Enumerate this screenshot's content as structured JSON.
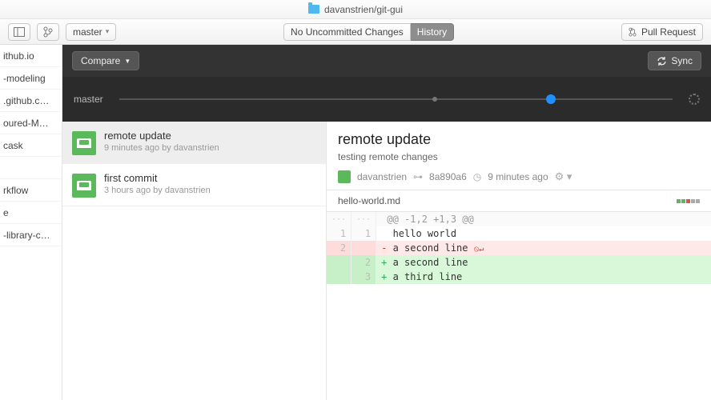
{
  "titlebar": {
    "path": "davanstrien/git-gui"
  },
  "toolbar": {
    "branch": "master",
    "tabs": {
      "changes": "No Uncommitted Changes",
      "history": "History"
    },
    "pull_request": "Pull Request"
  },
  "compare": {
    "label": "Compare",
    "sync": "Sync"
  },
  "timeline": {
    "branch_label": "master"
  },
  "repos": [
    "ithub.io",
    "-modeling",
    ".github.c…",
    "oured-M…",
    "cask",
    "",
    "rkflow",
    "e",
    "-library-c…"
  ],
  "commits": [
    {
      "title": "remote update",
      "sub": "9 minutes ago by davanstrien",
      "selected": true
    },
    {
      "title": "first commit",
      "sub": "3 hours ago by davanstrien",
      "selected": false
    }
  ],
  "detail": {
    "title": "remote update",
    "desc": "testing remote changes",
    "author": "davanstrien",
    "sha": "8a890a6",
    "time": "9 minutes ago",
    "file": "hello-world.md",
    "dots": [
      "#5bb85b",
      "#5bb85b",
      "#d9534f",
      "#aaa",
      "#aaa"
    ]
  },
  "diff": {
    "hunk": "@@ -1,2 +1,3 @@",
    "rows": [
      {
        "old": "1",
        "new": "1",
        "type": "ctx",
        "text": "hello world"
      },
      {
        "old": "2",
        "new": "",
        "type": "del",
        "text": "a second line",
        "noeol": true
      },
      {
        "old": "",
        "new": "2",
        "type": "add",
        "text": "a second line"
      },
      {
        "old": "",
        "new": "3",
        "type": "add",
        "text": "a third line"
      }
    ]
  }
}
